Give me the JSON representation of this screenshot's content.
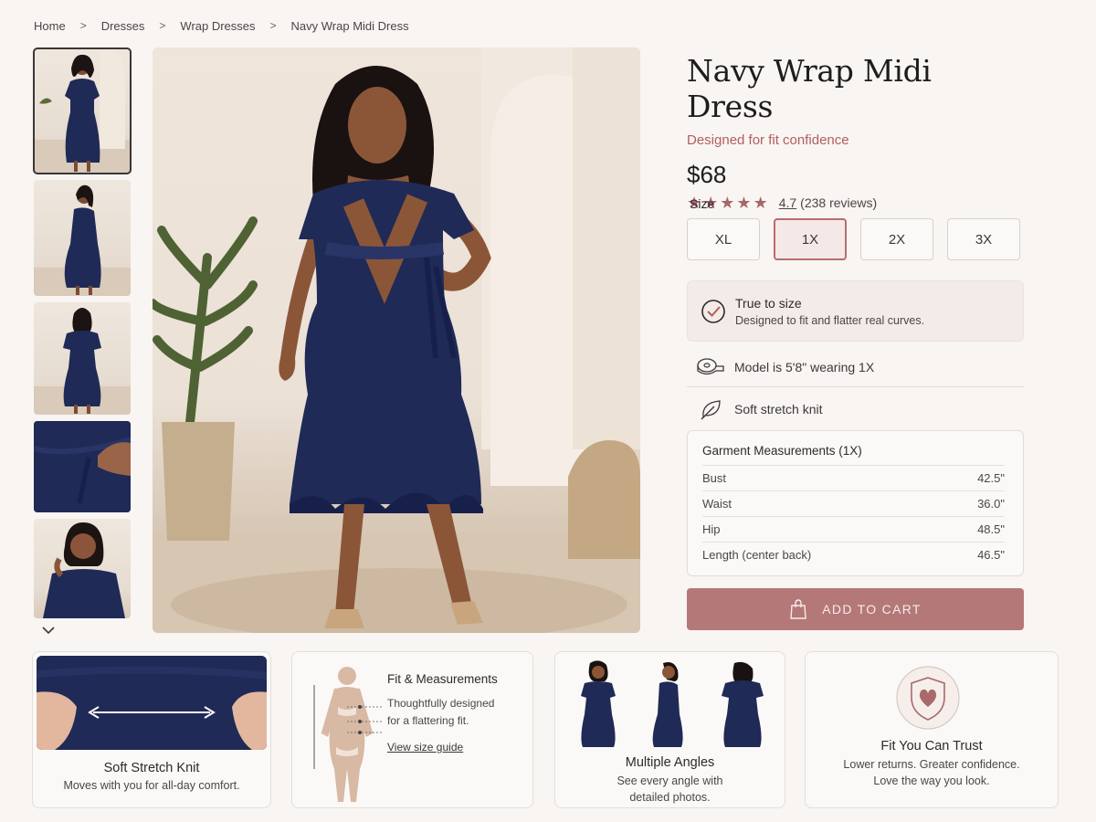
{
  "breadcrumb": [
    "Home",
    "Dresses",
    "Wrap Dresses",
    "Navy Wrap Midi Dress"
  ],
  "breadcrumb_separator": ">",
  "product": {
    "title": "Navy Wrap Midi Dress",
    "subtitle": "Designed for fit confidence",
    "price": "$68",
    "rating": {
      "stars": 5,
      "value": "4.7",
      "reviews": "(238 reviews)"
    }
  },
  "size": {
    "label": "Size",
    "options": [
      "XL",
      "1X",
      "2X",
      "3X"
    ],
    "selected": "1X"
  },
  "fit_note": {
    "title": "True to size",
    "text": "Designed to fit and flatter real curves."
  },
  "features": {
    "model": "Model is 5'8\" wearing 1X",
    "fabric": "Soft stretch knit"
  },
  "measurements": {
    "title": "Garment Measurements (1X)",
    "rows": [
      {
        "name": "Bust",
        "value": "42.5\""
      },
      {
        "name": "Waist",
        "value": "36.0\""
      },
      {
        "name": "Hip",
        "value": "48.5\""
      },
      {
        "name": "Length (center back)",
        "value": "46.5\""
      }
    ]
  },
  "cart": {
    "label": "ADD TO CART"
  },
  "cards": [
    {
      "title": "Soft Stretch Knit",
      "text": "Moves with you for all-day comfort."
    },
    {
      "title": "Fit & Measurements",
      "text_lines": [
        "Thoughtfully designed",
        "for a flattering fit."
      ],
      "link": "View size guide"
    },
    {
      "title": "Multiple Angles",
      "text_lines": [
        "See every angle with",
        "detailed photos."
      ]
    },
    {
      "title": "Fit You Can Trust",
      "text_lines": [
        "Lower returns. Greater confidence.",
        "Love the way you look."
      ]
    }
  ],
  "colors": {
    "accent": "#b25e5e",
    "star": "#a7676a",
    "cart_button": "#b47878",
    "dress_navy": "#1f2a56",
    "background": "#f8f5f2"
  },
  "icons": {
    "fit_note": "check-circle-icon",
    "model": "measuring-tape-icon",
    "fabric": "leaf-icon",
    "cart": "shopping-bag-icon",
    "thumbs_more": "chevron-down-icon",
    "trust": "heart-shield-icon"
  }
}
